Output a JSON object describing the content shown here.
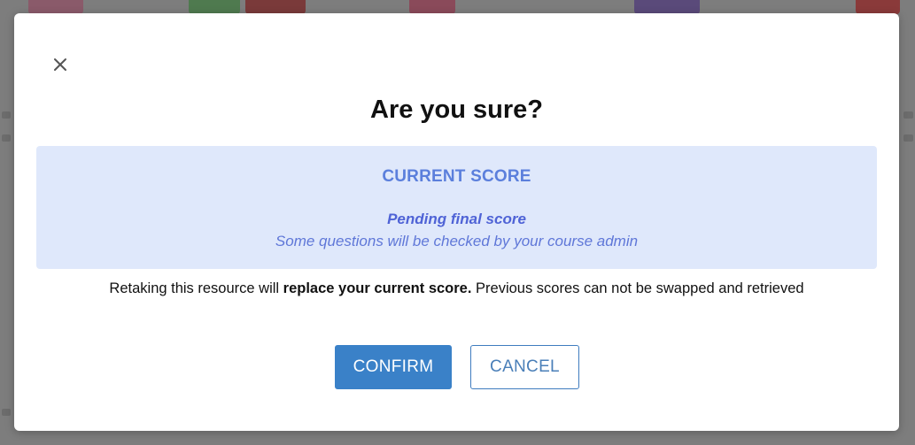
{
  "modal": {
    "title": "Are you sure?",
    "close_icon": "close-icon"
  },
  "score": {
    "heading": "CURRENT SCORE",
    "status": "Pending final score",
    "description": "Some questions will be checked by your course admin"
  },
  "warning": {
    "prefix": "Retaking this resource will ",
    "emphasis": "replace your current score.",
    "suffix": " Previous scores can not be swapped and retrieved"
  },
  "buttons": {
    "confirm": "CONFIRM",
    "cancel": "CANCEL"
  },
  "colors": {
    "confirm_bg": "#3a81c8",
    "score_box_bg": "#dfe8fb",
    "score_heading": "#5b7fdc",
    "backdrop": "#7d7d7d"
  }
}
